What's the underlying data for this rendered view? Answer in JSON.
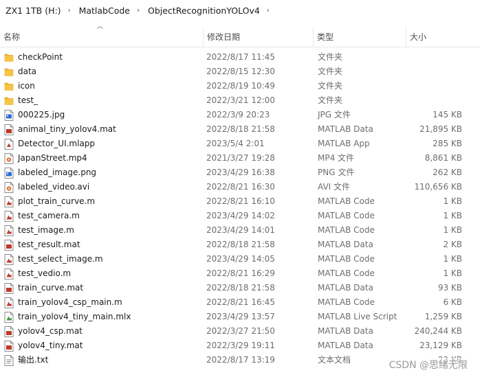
{
  "breadcrumb": [
    {
      "label": "ZX1 1TB (H:)"
    },
    {
      "label": "MatlabCode"
    },
    {
      "label": "ObjectRecognitionYOLOv4"
    }
  ],
  "columns": {
    "name": "名称",
    "date": "修改日期",
    "type": "类型",
    "size": "大小"
  },
  "accent_colors": {
    "folder": "#f2b32a",
    "matlab_data": "#c0392b",
    "jpg": "#2a6fd6",
    "video": "#e46f2f"
  },
  "files": [
    {
      "name": "checkPoint",
      "date": "2022/8/17 11:45",
      "type": "文件夹",
      "size": "",
      "icon": "folder"
    },
    {
      "name": "data",
      "date": "2022/8/15 12:30",
      "type": "文件夹",
      "size": "",
      "icon": "folder"
    },
    {
      "name": "icon",
      "date": "2022/8/19 10:49",
      "type": "文件夹",
      "size": "",
      "icon": "folder"
    },
    {
      "name": "test_",
      "date": "2022/3/21 12:00",
      "type": "文件夹",
      "size": "",
      "icon": "folder"
    },
    {
      "name": "000225.jpg",
      "date": "2022/3/9 20:23",
      "type": "JPG 文件",
      "size": "145 KB",
      "icon": "image"
    },
    {
      "name": "animal_tiny_yolov4.mat",
      "date": "2022/8/18 21:58",
      "type": "MATLAB Data",
      "size": "21,895 KB",
      "icon": "mat"
    },
    {
      "name": "Detector_UI.mlapp",
      "date": "2023/5/4 2:01",
      "type": "MATLAB App",
      "size": "285 KB",
      "icon": "app"
    },
    {
      "name": "JapanStreet.mp4",
      "date": "2021/3/27 19:28",
      "type": "MP4 文件",
      "size": "8,861 KB",
      "icon": "video"
    },
    {
      "name": "labeled_image.png",
      "date": "2023/4/29 16:38",
      "type": "PNG 文件",
      "size": "262 KB",
      "icon": "image"
    },
    {
      "name": "labeled_video.avi",
      "date": "2022/8/21 16:30",
      "type": "AVI 文件",
      "size": "110,656 KB",
      "icon": "video"
    },
    {
      "name": "plot_train_curve.m",
      "date": "2022/8/21 16:10",
      "type": "MATLAB Code",
      "size": "1 KB",
      "icon": "code"
    },
    {
      "name": "test_camera.m",
      "date": "2023/4/29 14:02",
      "type": "MATLAB Code",
      "size": "1 KB",
      "icon": "code"
    },
    {
      "name": "test_image.m",
      "date": "2023/4/29 14:01",
      "type": "MATLAB Code",
      "size": "1 KB",
      "icon": "code"
    },
    {
      "name": "test_result.mat",
      "date": "2022/8/18 21:58",
      "type": "MATLAB Data",
      "size": "2 KB",
      "icon": "mat"
    },
    {
      "name": "test_select_image.m",
      "date": "2023/4/29 14:05",
      "type": "MATLAB Code",
      "size": "1 KB",
      "icon": "code"
    },
    {
      "name": "test_vedio.m",
      "date": "2022/8/21 16:29",
      "type": "MATLAB Code",
      "size": "1 KB",
      "icon": "code"
    },
    {
      "name": "train_curve.mat",
      "date": "2022/8/18 21:58",
      "type": "MATLAB Data",
      "size": "93 KB",
      "icon": "mat"
    },
    {
      "name": "train_yolov4_csp_main.m",
      "date": "2022/8/21 16:45",
      "type": "MATLAB Code",
      "size": "6 KB",
      "icon": "code"
    },
    {
      "name": "train_yolov4_tiny_main.mlx",
      "date": "2023/4/29 13:57",
      "type": "MATLAB Live Script",
      "size": "1,259 KB",
      "icon": "live"
    },
    {
      "name": "yolov4_csp.mat",
      "date": "2022/3/27 21:50",
      "type": "MATLAB Data",
      "size": "240,244 KB",
      "icon": "mat"
    },
    {
      "name": "yolov4_tiny.mat",
      "date": "2022/3/29 19:11",
      "type": "MATLAB Data",
      "size": "23,129 KB",
      "icon": "mat"
    },
    {
      "name": "输出.txt",
      "date": "2022/8/17 13:19",
      "type": "文本文档",
      "size": "23 KB",
      "icon": "text"
    }
  ],
  "watermark": "CSDN @思绪无限"
}
